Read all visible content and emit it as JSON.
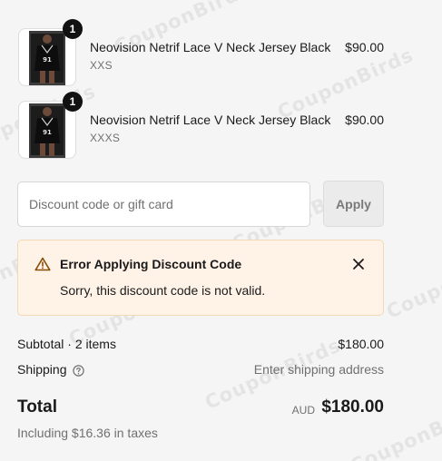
{
  "watermark": "CouponBirds",
  "items": [
    {
      "quantity": "1",
      "name": "Neovision Netrif Lace V Neck Jersey Black",
      "variant": "XXS",
      "price": "$90.00"
    },
    {
      "quantity": "1",
      "name": "Neovision Netrif Lace V Neck Jersey Black",
      "variant": "XXXS",
      "price": "$90.00"
    }
  ],
  "discount": {
    "placeholder": "Discount code or gift card",
    "value": "",
    "apply_label": "Apply"
  },
  "error_banner": {
    "title": "Error Applying Discount Code",
    "message": "Sorry, this discount code is not valid.",
    "icon": "warning-icon",
    "close_icon": "close-icon",
    "background_color": "#fff3e8"
  },
  "summary": {
    "subtotal_label": "Subtotal · 2 items",
    "subtotal_value": "$180.00",
    "shipping_label": "Shipping",
    "shipping_value": "Enter shipping address",
    "shipping_help_icon": "question-circle-icon",
    "total_label": "Total",
    "currency": "AUD",
    "total_value": "$180.00",
    "taxes_note": "Including $16.36 in taxes"
  }
}
